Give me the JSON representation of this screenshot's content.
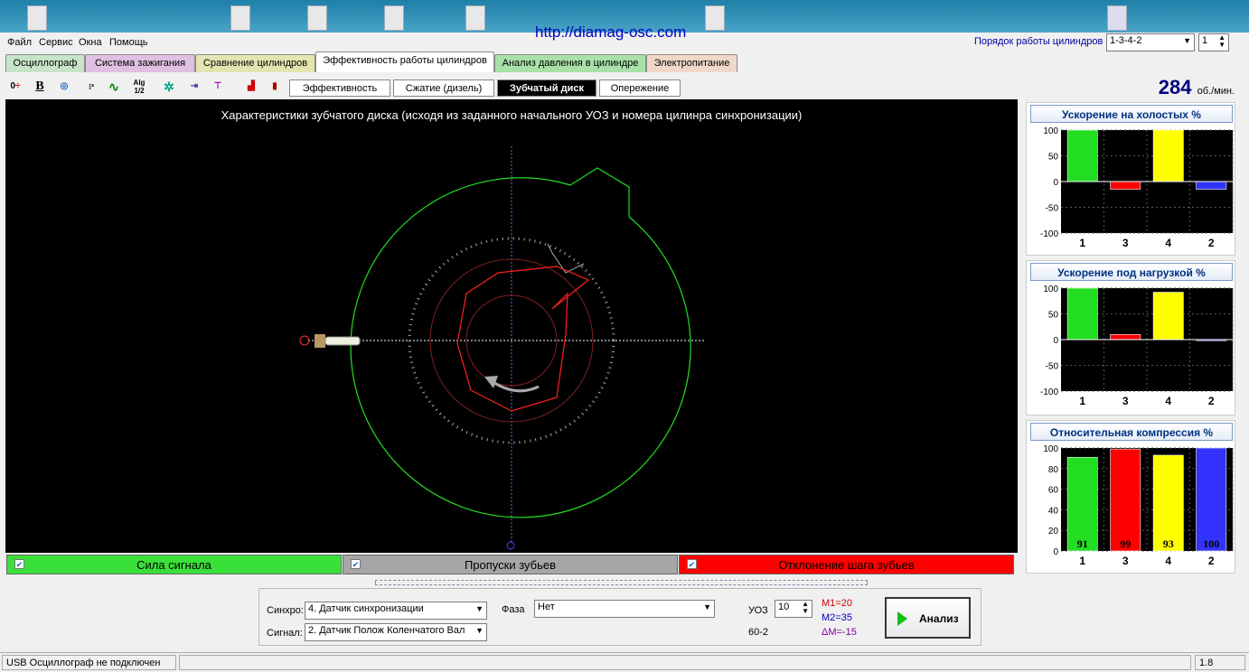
{
  "url": "http://diamag-osc.com",
  "menu": [
    "Файл",
    "Сервис",
    "Окна",
    "Помощь"
  ],
  "order": {
    "label": "Порядок работы цилиндров",
    "value": "1-3-4-2",
    "num": "1"
  },
  "tabs": [
    "Осциллограф",
    "Система зажигания",
    "Сравнение цилиндров",
    "Эффективность работы цилиндров",
    "Анализ давления в цилиндре",
    "Электропитание"
  ],
  "subtabs": [
    "Эффективность",
    "Сжатие (дизель)",
    "Зубчатый диск",
    "Опережение"
  ],
  "rpm": {
    "value": "284",
    "unit": "об./мин."
  },
  "chart_title": "Характеристики зубчатого диска (исходя из заданного начального УОЗ и номера цилинра синхронизации)",
  "legend": [
    "Сила сигнала",
    "Пропуски зубьев",
    "Отклонение шага зубьев"
  ],
  "colors": {
    "green": "#22dd22",
    "gray": "#a6a6a6",
    "red": "#ff0000",
    "yellow": "#ffff00",
    "blue": "#3333ff"
  },
  "chart_data": [
    {
      "type": "bar",
      "title": "Ускорение на холостых %",
      "categories": [
        "1",
        "3",
        "4",
        "2"
      ],
      "values": [
        100,
        -15,
        100,
        -15
      ],
      "ylim": [
        -100,
        100
      ],
      "yticks": [
        "100",
        "50",
        "0",
        "-50",
        "-100"
      ]
    },
    {
      "type": "bar",
      "title": "Ускорение под нагрузкой %",
      "categories": [
        "1",
        "3",
        "4",
        "2"
      ],
      "values": [
        100,
        10,
        92,
        -2
      ],
      "ylim": [
        -100,
        100
      ],
      "yticks": [
        "100",
        "50",
        "0",
        "-50",
        "-100"
      ]
    },
    {
      "type": "bar",
      "title": "Относительная компрессия %",
      "categories": [
        "1",
        "3",
        "4",
        "2"
      ],
      "values": [
        91,
        99,
        93,
        100
      ],
      "data_labels": [
        "91",
        "99",
        "93",
        "100"
      ],
      "ylim": [
        0,
        100
      ],
      "yticks": [
        "100",
        "80",
        "60",
        "40",
        "20",
        "0"
      ]
    }
  ],
  "bottom": {
    "sync_label": "Синхро:",
    "sync_value": "4. Датчик синхронизации",
    "signal_label": "Сигнал:",
    "signal_value": "2. Датчик Полож Коленчатого Вал",
    "phase_label": "Фаза",
    "phase_value": "Нет",
    "uoz_label": "УОЗ",
    "uoz_value": "10",
    "teeth": "60-2",
    "m1": "M1=20",
    "m2": "M2=35",
    "dm": "ΔM=-15",
    "analyze": "Анализ"
  },
  "status": {
    "text": "USB Осциллограф не подключен",
    "version": "1.8"
  }
}
